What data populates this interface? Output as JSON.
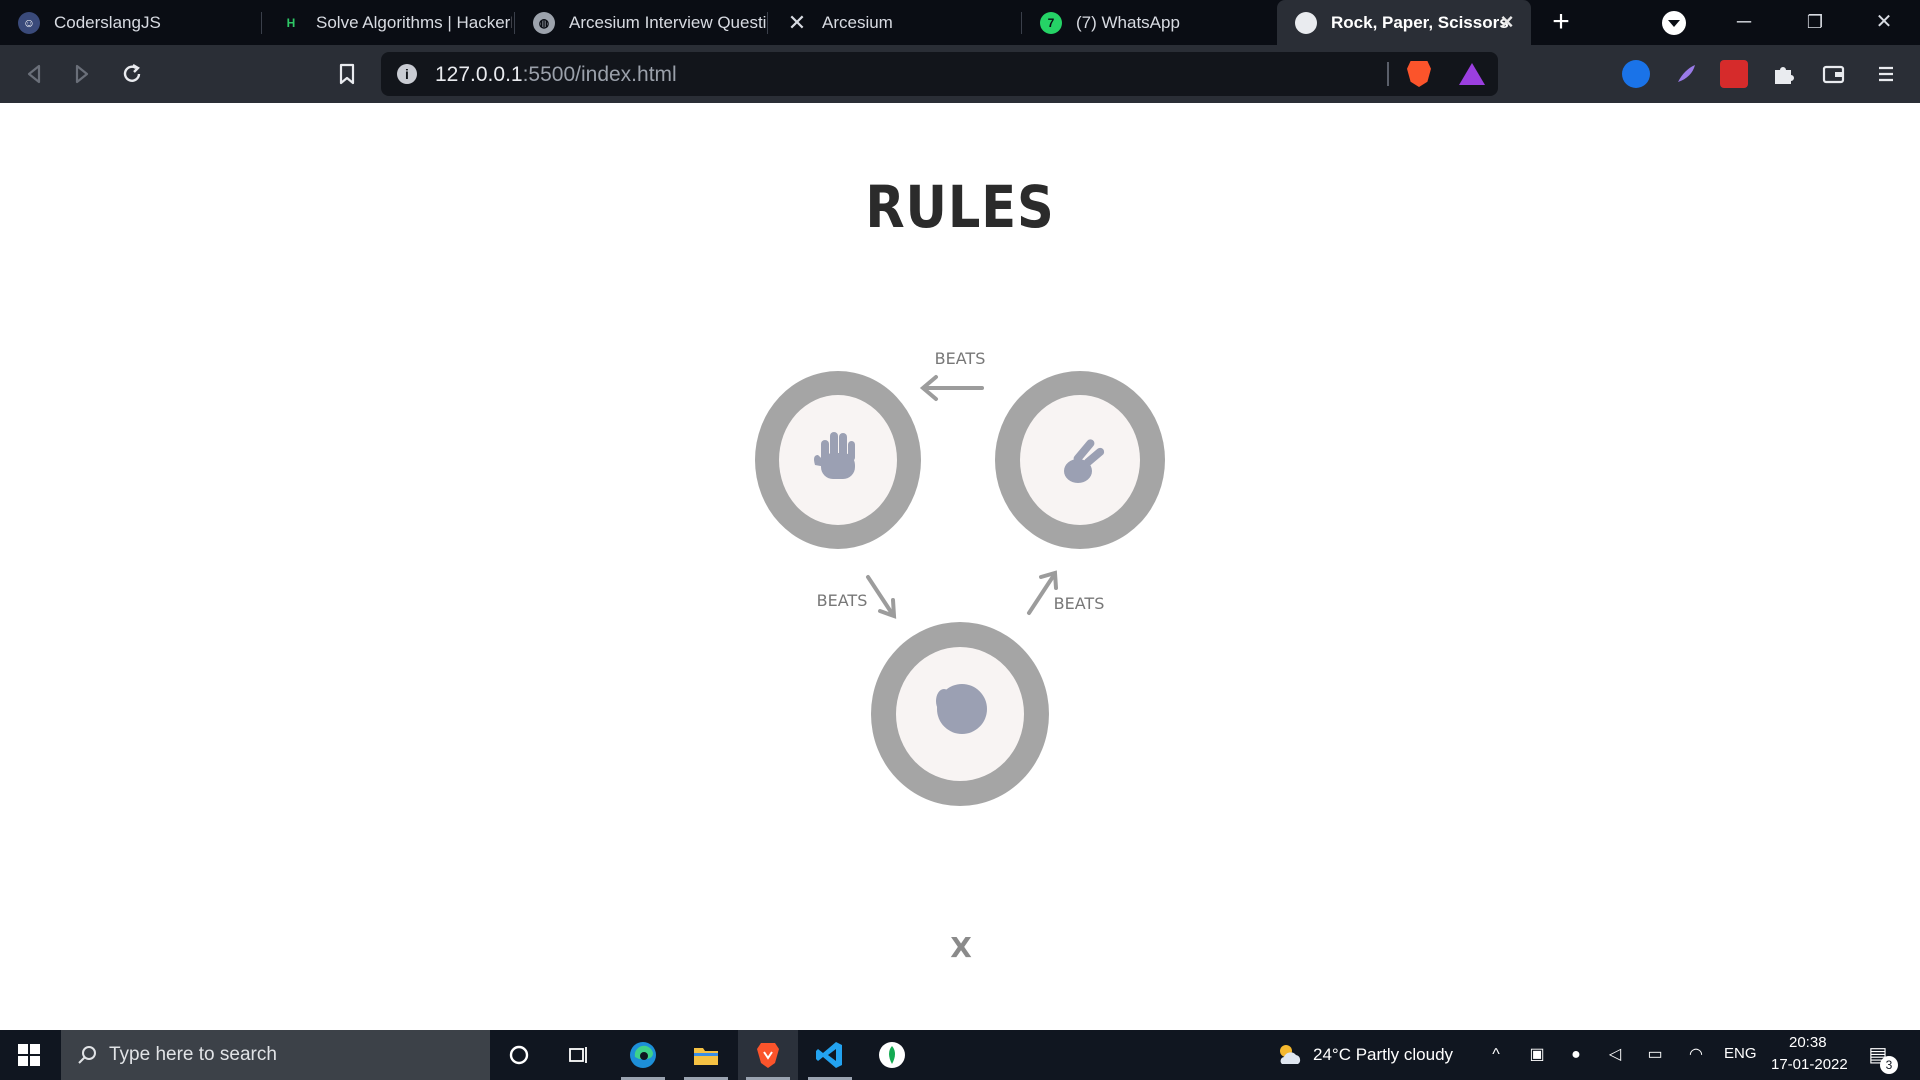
{
  "browser": {
    "tabs": [
      {
        "title": "CoderslangJS",
        "favicon": "coderslang-favicon",
        "active": false
      },
      {
        "title": "Solve Algorithms | HackerR",
        "favicon": "hackerrank-favicon",
        "active": false
      },
      {
        "title": "Arcesium Interview Questio",
        "favicon": "globe-favicon",
        "active": false
      },
      {
        "title": "Arcesium",
        "favicon": "arcesium-favicon",
        "active": false
      },
      {
        "title": "(7) WhatsApp",
        "favicon": "whatsapp-favicon",
        "badge": "7",
        "active": false
      },
      {
        "title": "Rock, Paper, Scissors",
        "favicon": "loading-favicon",
        "active": true
      }
    ],
    "new_tab": "+",
    "window_controls": {
      "minimize": "─",
      "restore": "❐",
      "close": "✕"
    },
    "address": {
      "host": "127.0.0.1",
      "rest": ":5500/index.html"
    },
    "info_icon": "i"
  },
  "page": {
    "title": "RULES",
    "beats_label": "BEATS",
    "close_label": "X",
    "moves": [
      "paper",
      "scissors",
      "rock"
    ],
    "colors": {
      "ring": "#a5a5a5",
      "inner": "#f8f4f3",
      "hand": "#9ba0b3",
      "arrow": "#9c9c9c",
      "label": "#777777"
    }
  },
  "taskbar": {
    "search_placeholder": "Type here to search",
    "weather": "24°C  Partly cloudy",
    "language": "ENG",
    "time": "20:38",
    "date": "17-01-2022",
    "notification_count": "3"
  }
}
